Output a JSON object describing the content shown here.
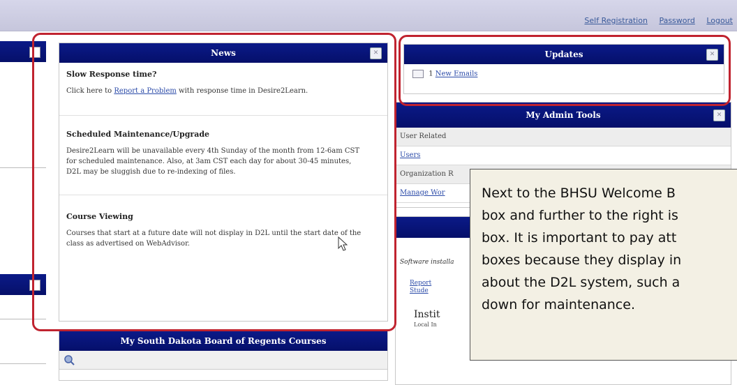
{
  "toplinks": [
    "Self Registration",
    "Password",
    "Logout"
  ],
  "news": {
    "title": "News",
    "items": [
      {
        "title": "Slow Response time?",
        "pre": "Click here to ",
        "link": "Report a Problem",
        "post": " with response time in Desire2Learn."
      },
      {
        "title": "Scheduled Maintenance/Upgrade",
        "lines": [
          "Desire2Learn will be unavailable every 4th Sunday of the month from 12-6am CST",
          "for scheduled maintenance.  Also, at 3am CST each day for about 30-45 minutes,",
          "D2L may be sluggish due to re-indexing of files."
        ]
      },
      {
        "title": "Course Viewing",
        "lines": [
          "Courses that start at a future date will not display in D2L until the start date of the",
          "class as advertised on WebAdvisor."
        ]
      }
    ]
  },
  "updates": {
    "title": "Updates",
    "count": "1",
    "link": "New Emails"
  },
  "admin": {
    "title": "My Admin Tools",
    "rows": [
      "User Related",
      "Users",
      "Organization R",
      "Manage Wor"
    ]
  },
  "lower_right": {
    "text1": "Software installa",
    "link1": "Report",
    "link2": "Stude",
    "inst": "Instit",
    "local": "Local In"
  },
  "courses": {
    "title": "My South Dakota Board of Regents Courses"
  },
  "callout": {
    "lines": [
      "Next to the BHSU Welcome B",
      "box and further to the right is",
      "box. It is important to pay att",
      "boxes because they display in",
      "about the D2L system, such a",
      "down for maintenance."
    ]
  }
}
